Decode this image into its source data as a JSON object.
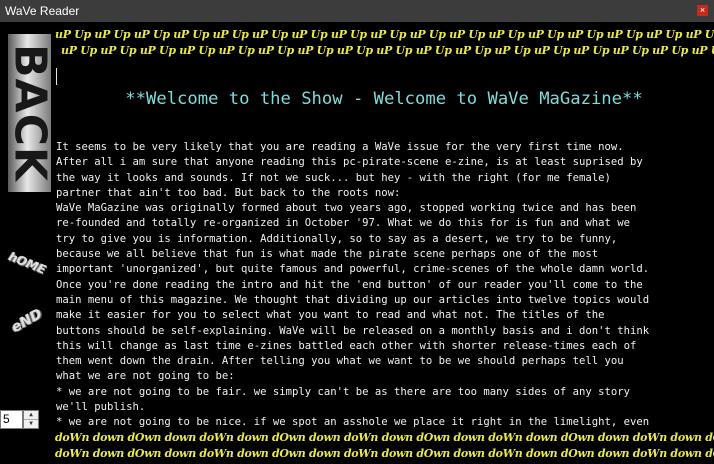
{
  "window": {
    "title": "WaVe Reader",
    "close_glyph": "×"
  },
  "nav": {
    "back_label": "BACK",
    "home_label": "hOME",
    "end_label": "eND"
  },
  "page_selector": {
    "value": "5",
    "up_glyph": "▲",
    "down_glyph": "▼"
  },
  "decor": {
    "top_pattern_line1": "uP Up uP Up uP Up uP Up uP Up uP Up uP Up uP Up uP Up uP Up uP Up uP Up uP Up uP Up uP Up uP Up uP Up uP Up uP Up uP Up uP Up uP Up uP",
    "top_pattern_line2": "uP Up uP Up uP Up uP Up uP Up uP Up uP Up uP Up uP Up uP Up uP Up uP Up uP Up uP Up uP Up uP Up uP Up uP Up uP Up uP Up uP Up uP Up uP",
    "bottom_pattern_line1": "doWn down dOwn down doWn down dOwn down doWn down dOwn down doWn down dOwn down doWn down dOwn down doWn down dOwn down",
    "bottom_pattern_line2": "doWn down dOwn down doWn down dOwn down doWn down dOwn down doWn down dOwn down doWn down dOwn down doWn down dOwn down"
  },
  "article": {
    "heading": "**Welcome to the Show - Welcome to WaVe MaGazine**",
    "lines": [
      "It seems to be very likely that you are reading a WaVe issue for the very first time now.",
      "After all i am sure that anyone reading this pc-pirate-scene e-zine, is at least suprised by",
      "the way it looks and sounds. If not we suck... but hey - with the right (for me female)",
      "partner that ain't too bad. But back to the roots now:",
      "WaVe MaGazine was originally formed about two years ago, stopped working twice and has been",
      "re-founded and totally re-organized in October '97. What we do this for is fun and what we",
      "try to give you is information. Additionally, so to say as a desert, we try to be funny,",
      "because we all believe that fun is what made the pirate scene perhaps one of the most",
      "important 'unorganized', but quite famous and powerful, crime-scenes of the whole damn world.",
      "Once you're done reading the intro and hit the 'end button' of our reader you'll come to the",
      "main menu of this magazine. We thought that dividing up our articles into twelve topics would",
      "make it easier for you to select what you want to read and what not. The titles of the",
      "buttons should be self-explaining. WaVe will be released on a monthly basis and i don't think",
      "this will change as last time e-zines battled each other with shorter release-times each of",
      "them went down the drain. After telling you what we want to be we should perhaps tell you",
      "what we are not going to be:",
      "* we are not going to be fair. we simply can't be as there are too many sides of any story",
      "we'll publish.",
      "* we are not going to be nice. if we spot an asshole we place it right in the limelight, even"
    ]
  },
  "colors": {
    "background": "#000000",
    "heading": "#7fdcdc",
    "body_text": "#f0f0f0",
    "pattern": "#e8e84a",
    "titlebar": "#3c3c3c",
    "close_button": "#c42b1c"
  }
}
